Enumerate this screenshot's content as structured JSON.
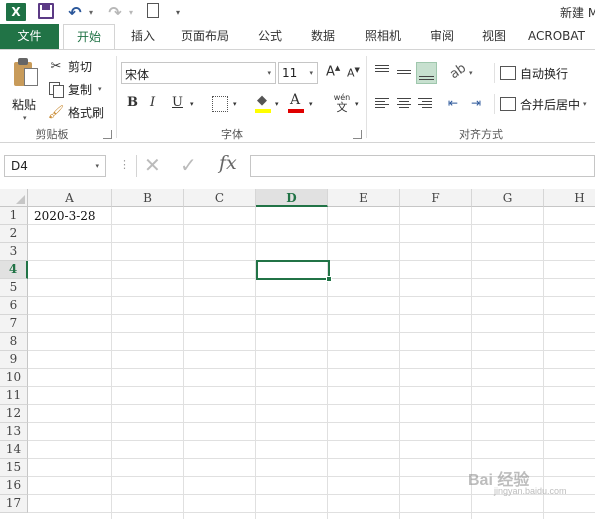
{
  "titlebar": {
    "app_logo": "X",
    "window_title": "新建 M",
    "undo_glyph": "↶",
    "redo_glyph": "↷",
    "dropdown_glyph": "▾"
  },
  "tabs": {
    "file": "文件",
    "home": "开始",
    "insert": "插入",
    "page_layout": "页面布局",
    "formulas": "公式",
    "data": "数据",
    "photo_album": "照相机",
    "review": "审阅",
    "view": "视图",
    "acrobat": "ACROBAT"
  },
  "ribbon": {
    "clipboard": {
      "paste": "粘贴",
      "cut": "剪切",
      "copy": "复制",
      "format_painter": "格式刷",
      "group_label": "剪贴板",
      "cut_glyph": "✂",
      "painter_glyph": "🖌"
    },
    "font": {
      "font_name": "宋体",
      "font_size": "11",
      "grow_glyph": "A",
      "shrink_glyph": "A",
      "bold": "B",
      "italic": "I",
      "underline": "U",
      "font_color_glyph": "A",
      "fill_glyph": "◆",
      "phonetic_top": "wén",
      "phonetic_bottom": "文",
      "group_label": "字体",
      "fill_color": "#ffff00",
      "font_color": "#e00000"
    },
    "alignment": {
      "wrap_text": "自动换行",
      "merge_center": "合并后居中",
      "group_label": "对齐方式",
      "orientation_glyph": "ab",
      "indent_dec_glyph": "⇤",
      "indent_inc_glyph": "⇥"
    }
  },
  "formula_bar": {
    "name_box": "D4",
    "cancel_glyph": "✕",
    "enter_glyph": "✓",
    "fx": "fx",
    "content": ""
  },
  "grid": {
    "columns": [
      "A",
      "B",
      "C",
      "D",
      "E",
      "F",
      "G",
      "H"
    ],
    "selected_column": "D",
    "rows": [
      "1",
      "2",
      "3",
      "4",
      "5",
      "6",
      "7",
      "8",
      "9",
      "10",
      "11",
      "12",
      "13",
      "14",
      "15",
      "16",
      "17"
    ],
    "selected_row": "4",
    "active_cell": "D4",
    "cells": {
      "A1": "2020-3-28"
    }
  },
  "watermark": {
    "text": "Bai 经验",
    "sub": "jingyan.baidu.com"
  },
  "colors": {
    "excel_green": "#217346",
    "header_bg": "#f3f3f3"
  }
}
